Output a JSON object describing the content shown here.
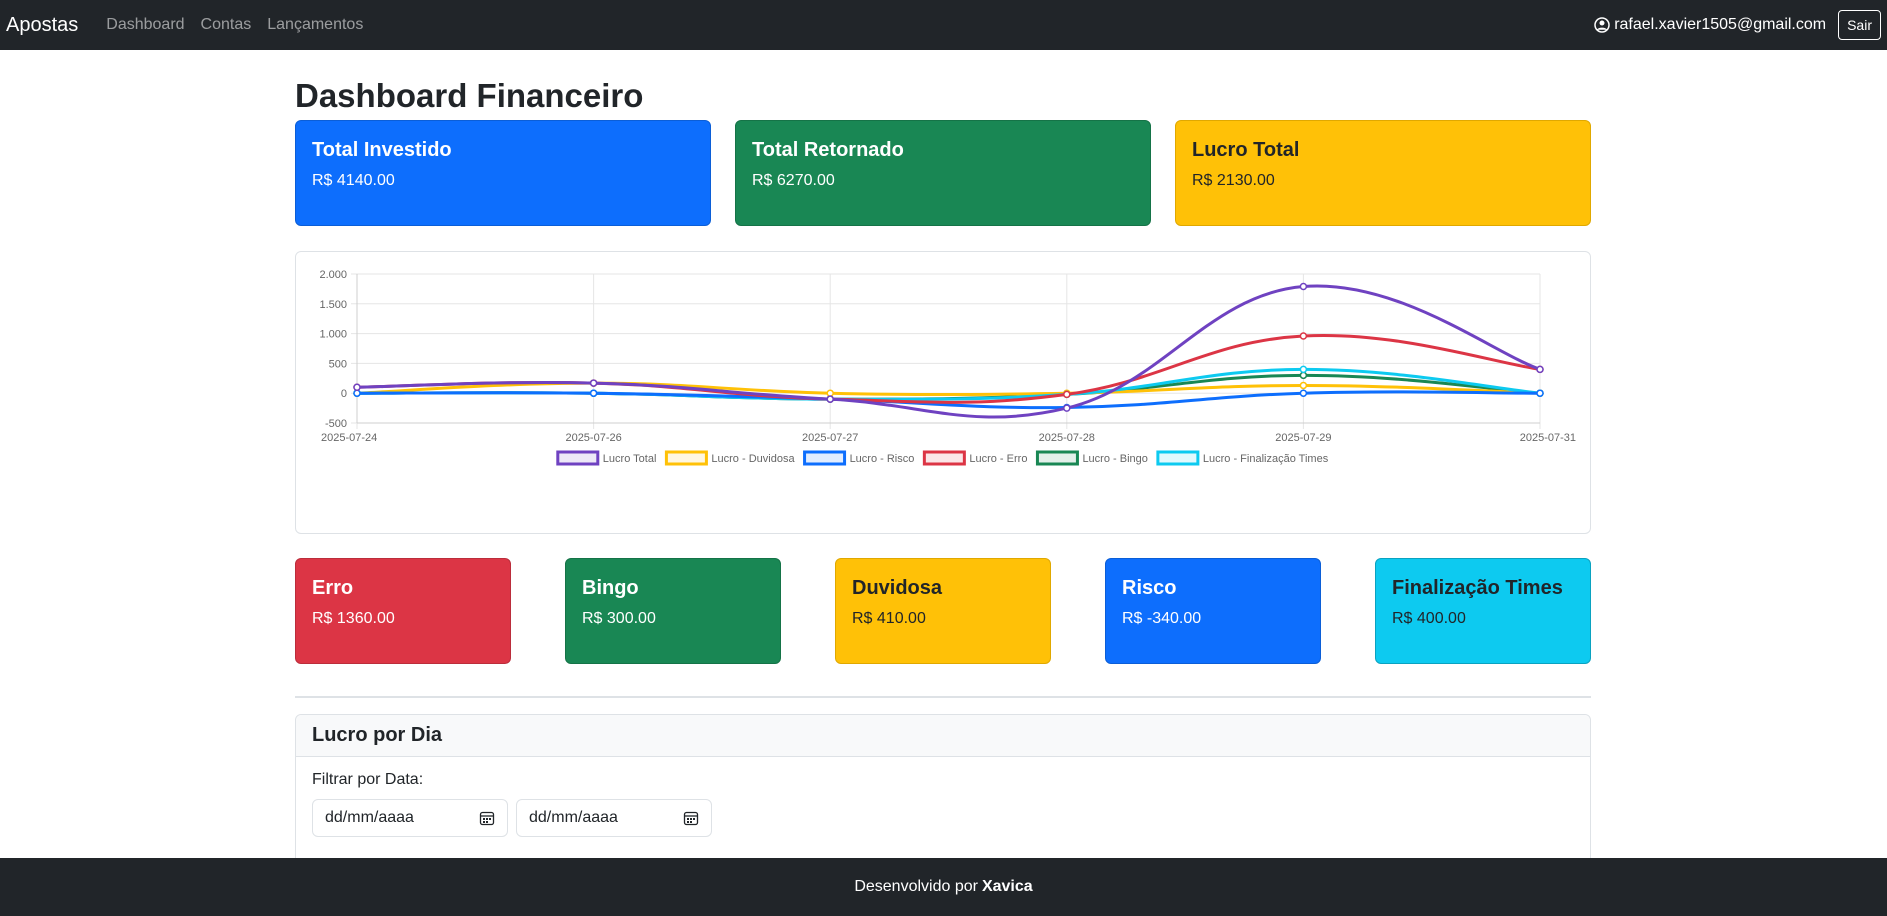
{
  "navbar": {
    "brand": "Apostas",
    "links": [
      "Dashboard",
      "Contas",
      "Lançamentos"
    ],
    "user_email": "rafael.xavier1505@gmail.com",
    "logout_label": "Sair"
  },
  "page_title": "Dashboard Financeiro",
  "summary_cards": [
    {
      "title": "Total Investido",
      "value": "R$ 4140.00",
      "color": "#0d6efd"
    },
    {
      "title": "Total Retornado",
      "value": "R$ 6270.00",
      "color": "#198754"
    },
    {
      "title": "Lucro Total",
      "value": "R$ 2130.00",
      "color": "#ffc107"
    }
  ],
  "category_cards": [
    {
      "title": "Erro",
      "value": "R$ 1360.00",
      "color": "#dc3545"
    },
    {
      "title": "Bingo",
      "value": "R$ 300.00",
      "color": "#198754"
    },
    {
      "title": "Duvidosa",
      "value": "R$ 410.00",
      "color": "#ffc107"
    },
    {
      "title": "Risco",
      "value": "R$ -340.00",
      "color": "#0d6efd"
    },
    {
      "title": "Finalização Times",
      "value": "R$ 400.00",
      "color": "#0dcaf0"
    }
  ],
  "chart_data": {
    "type": "line",
    "categories": [
      "2025-07-24",
      "2025-07-26",
      "2025-07-27",
      "2025-07-28",
      "2025-07-29",
      "2025-07-31"
    ],
    "ylim": [
      -500,
      2000
    ],
    "yticks": [
      -500,
      0,
      500,
      1000,
      1500,
      2000
    ],
    "ytick_labels": [
      "-500",
      "0",
      "500",
      "1.000",
      "1.500",
      "2.000"
    ],
    "grid": true,
    "legend_position": "bottom",
    "series": [
      {
        "name": "Lucro - Bingo",
        "color": "#198754",
        "values": [
          0,
          0,
          -100,
          -20,
          300,
          0
        ]
      },
      {
        "name": "Lucro - Duvidosa",
        "color": "#ffc107",
        "values": [
          0,
          170,
          0,
          0,
          130,
          0
        ]
      },
      {
        "name": "Lucro - Finalização Times",
        "color": "#0dcaf0",
        "values": [
          0,
          0,
          -100,
          -20,
          400,
          0
        ]
      },
      {
        "name": "Lucro - Risco",
        "color": "#0d6efd",
        "values": [
          0,
          0,
          -100,
          -240,
          0,
          0
        ]
      },
      {
        "name": "Lucro - Erro",
        "color": "#dc3545",
        "values": [
          100,
          170,
          -100,
          -20,
          960,
          400
        ]
      },
      {
        "name": "Lucro Total",
        "color": "#6f42c1",
        "values": [
          100,
          170,
          -100,
          -250,
          1790,
          400
        ]
      }
    ],
    "legend_order": [
      "Lucro Total",
      "Lucro - Duvidosa",
      "Lucro - Risco",
      "Lucro - Erro",
      "Lucro - Bingo",
      "Lucro - Finalização Times"
    ]
  },
  "day_section": {
    "title": "Lucro por Dia",
    "filter_label": "Filtrar por Data:",
    "start_placeholder": "dd/mm/aaaa",
    "end_placeholder": "dd/mm/aaaa"
  },
  "footer": {
    "text": "Desenvolvido por",
    "author": "Xavica"
  }
}
